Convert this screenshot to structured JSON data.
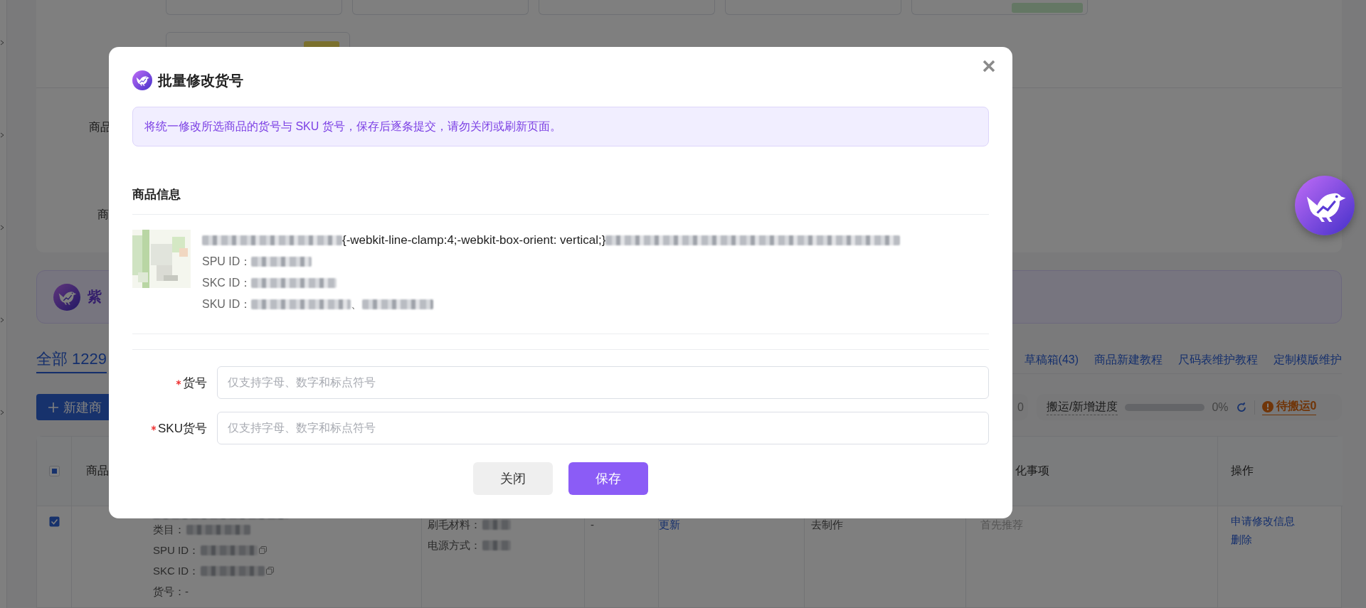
{
  "background_page": {
    "filter_labels": [
      "商品",
      "商"
    ],
    "banner": {
      "title": "紫"
    },
    "tabs": [
      {
        "label": "全部 1229",
        "selected": true
      }
    ],
    "new_button": {
      "label": "新建商"
    },
    "links": [
      "草稿箱(43)",
      "商品新建教程",
      "尺码表维护教程",
      "定制模版维护"
    ],
    "counter_partial": "0",
    "progress": {
      "label": "搬运/新增进度",
      "level": 0,
      "reading": "0%"
    },
    "pending": {
      "label": "待搬运0"
    },
    "table": {
      "select_all_indeterminate": true,
      "columns": [
        "商品",
        "化事项",
        "操作"
      ],
      "rows": [
        {
          "selected": true,
          "category_label": "类目：",
          "spu_label": "SPU ID：",
          "skc_label": "SKC ID：",
          "item_no": "货号：-",
          "attributes": [
            "刷毛材料：",
            "电源方式："
          ],
          "column_3": "-",
          "column_4": "更新",
          "column_5": "去制作",
          "column_6": "首先推荐",
          "actions": [
            "申请修改信息",
            "删除"
          ]
        }
      ]
    }
  },
  "dialog": {
    "title": "批量修改货号",
    "notice": "将统一修改所选商品的货号与 SKU 货号，保存后逐条提交，请勿关闭或刷新页面。",
    "section_title": "商品信息",
    "product": {
      "title_visible": "{-webkit-line-clamp:4;-webkit-box-orient: vertical;}",
      "spu_label": "SPU ID：",
      "skc_label": "SKC ID：",
      "sku_label": "SKU ID：",
      "sku_separator": "、"
    },
    "fields": [
      {
        "label": "货号",
        "required": true,
        "placeholder": "仅支持字母、数字和标点符号"
      },
      {
        "label": "SKU货号",
        "required": true,
        "placeholder": "仅支持字母、数字和标点符号"
      }
    ],
    "buttons": [
      {
        "label": "关闭",
        "kind": "secondary"
      },
      {
        "label": "保存",
        "kind": "primary"
      }
    ]
  }
}
